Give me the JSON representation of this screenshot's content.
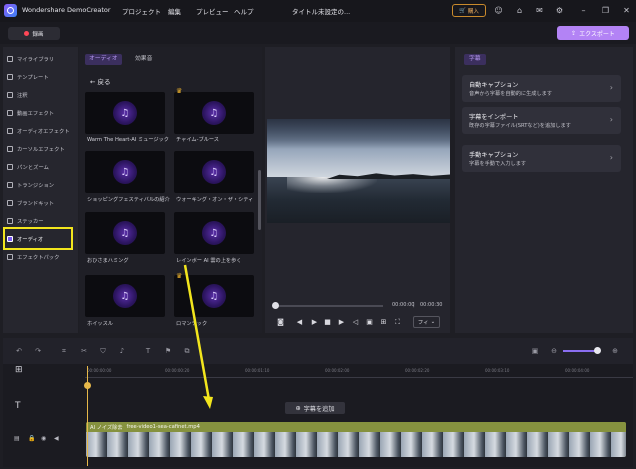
{
  "app": {
    "title": "Wondershare DemoCreator",
    "project_title": "タイトル未設定の..."
  },
  "menu": [
    "プロジェクト",
    "編集",
    "プレビュー",
    "ヘルプ"
  ],
  "topbar": {
    "purchase": "購入",
    "record": "録画",
    "export": "エクスポート"
  },
  "sidebar": {
    "items": [
      {
        "label": "マイライブラリ",
        "icon": "folder-icon"
      },
      {
        "label": "テンプレート",
        "icon": "template-icon"
      },
      {
        "label": "注釈",
        "icon": "annotation-icon"
      },
      {
        "label": "動画エフェクト",
        "icon": "video-effect-icon"
      },
      {
        "label": "オーディオエフェクト",
        "icon": "audio-effect-icon"
      },
      {
        "label": "カーソルエフェクト",
        "icon": "cursor-icon"
      },
      {
        "label": "パンとズーム",
        "icon": "pan-zoom-icon"
      },
      {
        "label": "トランジション",
        "icon": "transition-icon"
      },
      {
        "label": "ブランドキット",
        "icon": "brand-icon"
      },
      {
        "label": "ステッカー",
        "icon": "sticker-icon"
      },
      {
        "label": "オーディオ",
        "icon": "music-icon",
        "active": true
      },
      {
        "label": "エフェクトパック",
        "icon": "effect-pack-icon"
      }
    ]
  },
  "library": {
    "tabs": [
      "オーディオ",
      "効果音"
    ],
    "back": "戻る",
    "cards": [
      {
        "label": "Warm The Heart-AI ミュージック",
        "premium": false
      },
      {
        "label": "チャイム-ブルース",
        "premium": true
      },
      {
        "label": "ショッピングフェスティバルの紹介",
        "premium": false
      },
      {
        "label": "ウォーキング・オン・ザ・シティ",
        "premium": false
      },
      {
        "label": "おひさまハミング",
        "premium": false
      },
      {
        "label": "レインボー AI 雲の上を歩く",
        "premium": false
      },
      {
        "label": "ホイッスル",
        "premium": false
      },
      {
        "label": "ロマンチック",
        "premium": true
      }
    ]
  },
  "player": {
    "current": "00:00:00",
    "total": "00:00:30",
    "fit": "フィ",
    "progress": 0.02
  },
  "subtitle": {
    "tab": "字幕",
    "cards": [
      {
        "title": "自動キャプション",
        "desc": "音声から字幕を自動的に生成します"
      },
      {
        "title": "字幕をインポート",
        "desc": "既存の字幕ファイル(SRTなど)を追加します"
      },
      {
        "title": "手動キャプション",
        "desc": "字幕を手動で入力します"
      }
    ]
  },
  "timeline": {
    "ticks": [
      "00:00:00:00",
      "00:00:00:20",
      "00:00:01:10",
      "00:00:02:00",
      "00:00:02:20",
      "00:00:03:10",
      "00:00:04:00"
    ],
    "add_subtitle": "字幕を追加",
    "clip_badge": "AI ノイズ除去",
    "clip_name": "free-video1-sea-cafinet.mp4",
    "zoom": 0.85
  },
  "colors": {
    "accent": "#b383f5",
    "highlight": "#f2e51d",
    "clip": "#6d7a3a"
  }
}
